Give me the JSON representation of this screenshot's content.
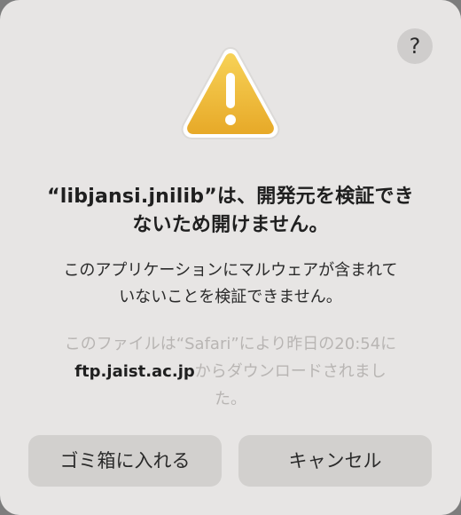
{
  "dialog": {
    "help_label": "?",
    "icon": "warning-triangle-icon",
    "accent": "#f0b62c",
    "title_line1": "“libjansi.jnilib”は、開発元を検証でき",
    "title_line2": "ないため開けません。",
    "message_line1": "このアプリケーションにマルウェアが含まれて",
    "message_line2": "いないことを検証できません。",
    "info_line1": "このファイルは“Safari”により昨日の20:54に",
    "info_host": "ftp.jaist.ac.jp",
    "info_line2_rest": "からダウンロードされまし",
    "info_line3": "た。",
    "buttons": {
      "move_to_trash": "ゴミ箱に入れる",
      "cancel": "キャンセル"
    }
  }
}
